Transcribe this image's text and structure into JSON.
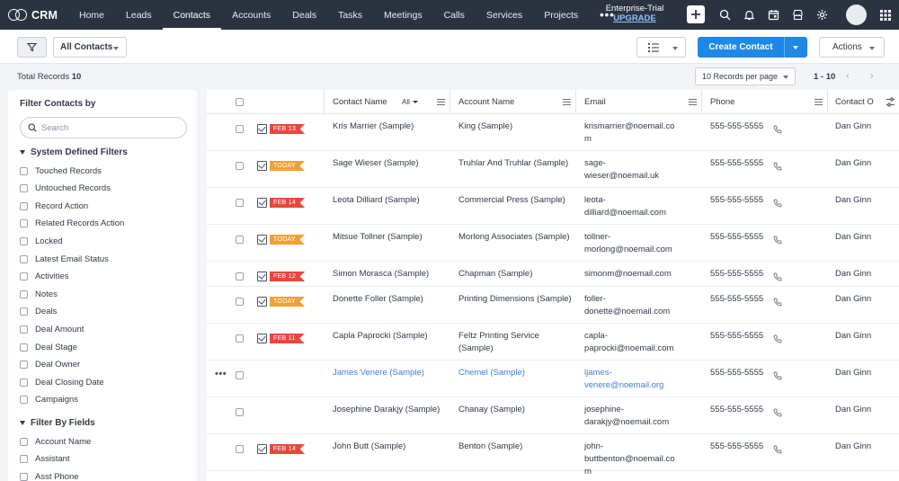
{
  "app": {
    "logo_text": "CRM"
  },
  "nav": {
    "tabs": [
      "Home",
      "Leads",
      "Contacts",
      "Accounts",
      "Deals",
      "Tasks",
      "Meetings",
      "Calls",
      "Services",
      "Projects"
    ],
    "active": "Contacts",
    "more": "•••",
    "trial_title": "Enterprise-Trial",
    "upgrade": "UPGRADE"
  },
  "toolbar": {
    "view": "All Contacts",
    "create": "Create Contact",
    "actions": "Actions"
  },
  "records": {
    "total_label": "Total Records",
    "total": "10",
    "per_page": "10 Records per page",
    "range": "1 - 10"
  },
  "sidebar": {
    "title": "Filter Contacts by",
    "search_placeholder": "Search",
    "section1": "System Defined Filters",
    "section1_items": [
      "Touched Records",
      "Untouched Records",
      "Record Action",
      "Related Records Action",
      "Locked",
      "Latest Email Status",
      "Activities",
      "Notes",
      "Deals",
      "Deal Amount",
      "Deal Stage",
      "Deal Owner",
      "Deal Closing Date",
      "Campaigns"
    ],
    "section2": "Filter By Fields",
    "section2_items": [
      "Account Name",
      "Assistant",
      "Asst Phone"
    ]
  },
  "table": {
    "columns": {
      "contact_name": "Contact Name",
      "contact_filter": "All",
      "account_name": "Account Name",
      "email": "Email",
      "phone": "Phone",
      "owner": "Contact O"
    },
    "rows": [
      {
        "tag": "FEB 13",
        "tag_color": "#e8473e",
        "name": "Kris Marrier (Sample)",
        "account": "King (Sample)",
        "email": [
          "krismarrier@noemail.co",
          "m"
        ],
        "phone": "555-555-5555",
        "owner": "Dan Ginn"
      },
      {
        "tag": "TODAY",
        "tag_color": "#f0a136",
        "name": "Sage Wieser (Sample)",
        "account": "Truhlar And Truhlar (Sample)",
        "email": [
          "sage-",
          "wieser@noemail.uk"
        ],
        "phone": "555-555-5555",
        "owner": "Dan Ginn"
      },
      {
        "tag": "FEB 14",
        "tag_color": "#e8473e",
        "name": "Leota Dilliard (Sample)",
        "account": "Commercial Press (Sample)",
        "email": [
          "leota-",
          "dilliard@noemail.com"
        ],
        "phone": "555-555-5555",
        "owner": "Dan Ginn"
      },
      {
        "tag": "TODAY",
        "tag_color": "#f0a136",
        "name": "Mitsue Tollner (Sample)",
        "account": "Morlong Associates (Sample)",
        "email": [
          "tollner-",
          "morlong@noemail.com"
        ],
        "phone": "555-555-5555",
        "owner": "Dan Ginn"
      },
      {
        "tag": "FEB 12",
        "tag_color": "#e8473e",
        "name": "Simon Morasca (Sample)",
        "account": "Chapman (Sample)",
        "email": [
          "simonm@noemail.com"
        ],
        "phone": "555-555-5555",
        "owner": "Dan Ginn"
      },
      {
        "tag": "TODAY",
        "tag_color": "#f0a136",
        "name": "Donette Foller (Sample)",
        "account": "Printing Dimensions (Sample)",
        "email": [
          "foller-",
          "donette@noemail.com"
        ],
        "phone": "555-555-5555",
        "owner": "Dan Ginn"
      },
      {
        "tag": "FEB 11",
        "tag_color": "#e8473e",
        "name": "Capla Paprocki (Sample)",
        "account": "Feltz Printing Service (Sample)",
        "email": [
          "capla-",
          "paprocki@noemail.com"
        ],
        "phone": "555-555-5555",
        "owner": "Dan Ginn"
      },
      {
        "tag": "",
        "tag_color": "",
        "name": "James Venere (Sample)",
        "account": "Chemel (Sample)",
        "email": [
          "ljames-",
          "venere@noemail.org"
        ],
        "phone": "555-555-5555",
        "owner": "Dan Ginn",
        "highlight": true,
        "more": "•••"
      },
      {
        "tag": "",
        "tag_color": "",
        "name": "Josephine Darakjy (Sample)",
        "account": "Chanay (Sample)",
        "email": [
          "josephine-",
          "darakjy@noemail.com"
        ],
        "phone": "555-555-5555",
        "owner": "Dan Ginn"
      },
      {
        "tag": "FEB 14",
        "tag_color": "#e8473e",
        "name": "John Butt (Sample)",
        "account": "Benton (Sample)",
        "email": [
          "john-",
          "buttbenton@noemail.co",
          "m"
        ],
        "phone": "555-555-5555",
        "owner": "Dan Ginn"
      }
    ]
  },
  "colors": {
    "nav_bg": "#2c3340",
    "accent": "#1e88e5",
    "tag_red": "#e8473e",
    "tag_orange": "#f0a136",
    "link": "#3f81d6"
  }
}
